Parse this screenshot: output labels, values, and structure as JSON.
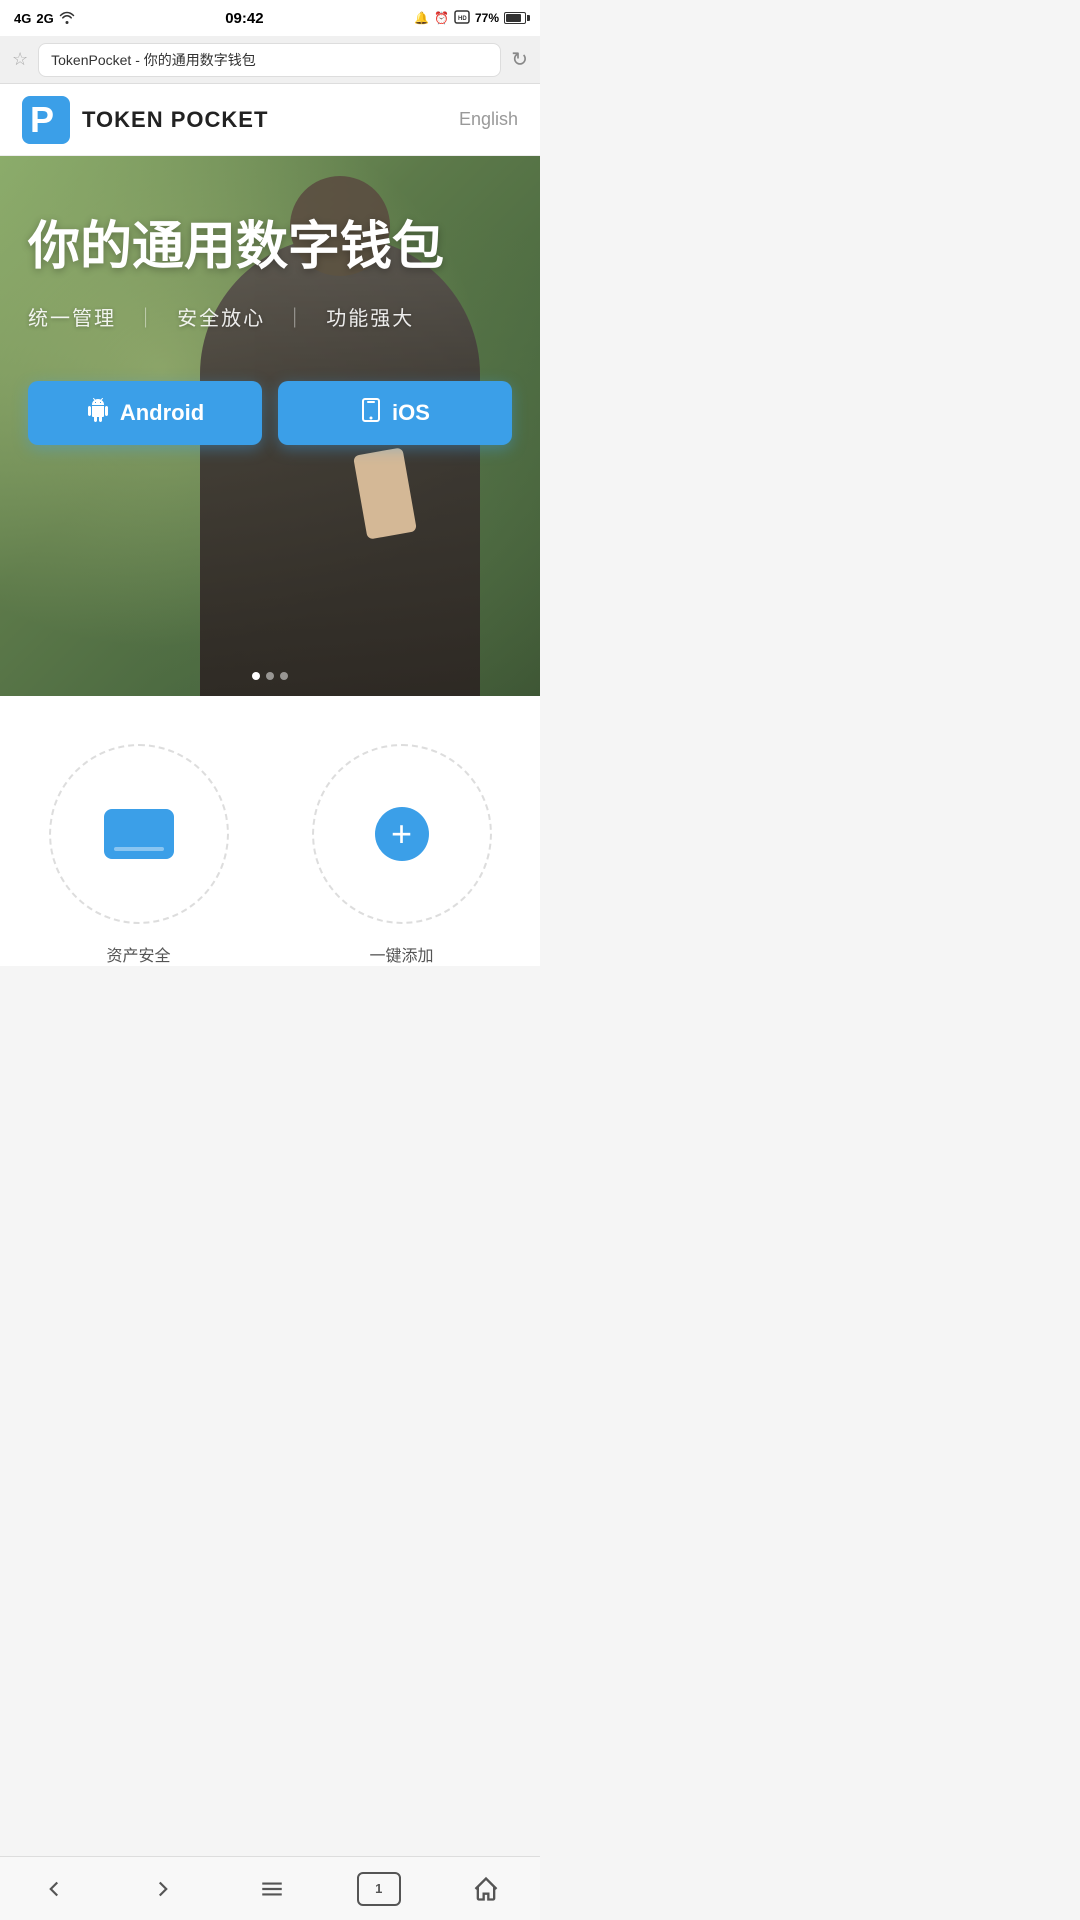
{
  "statusBar": {
    "time": "09:42",
    "signal1": "4G",
    "signal2": "2G",
    "wifi": "wifi",
    "battery": "77%",
    "alarmIcon": "🔔",
    "clockIcon": "⏰",
    "phoneIcon": "📞"
  },
  "browserBar": {
    "url": "TokenPocket - 你的通用数字钱包",
    "starIcon": "☆",
    "refreshIcon": "↻"
  },
  "header": {
    "logoText": "TOKEN POCKET",
    "langButton": "English"
  },
  "hero": {
    "title": "你的通用数字钱包",
    "subtitle1": "统一管理",
    "subtitle2": "安全放心",
    "subtitle3": "功能强大",
    "androidBtn": "Android",
    "iosBtn": "iOS"
  },
  "features": [
    {
      "iconType": "card",
      "label": "资产安全"
    },
    {
      "iconType": "plus",
      "label": "一键添加"
    }
  ],
  "bottomNav": {
    "back": "‹",
    "forward": "›",
    "menu": "≡",
    "tabs": "1",
    "home": "⌂"
  }
}
